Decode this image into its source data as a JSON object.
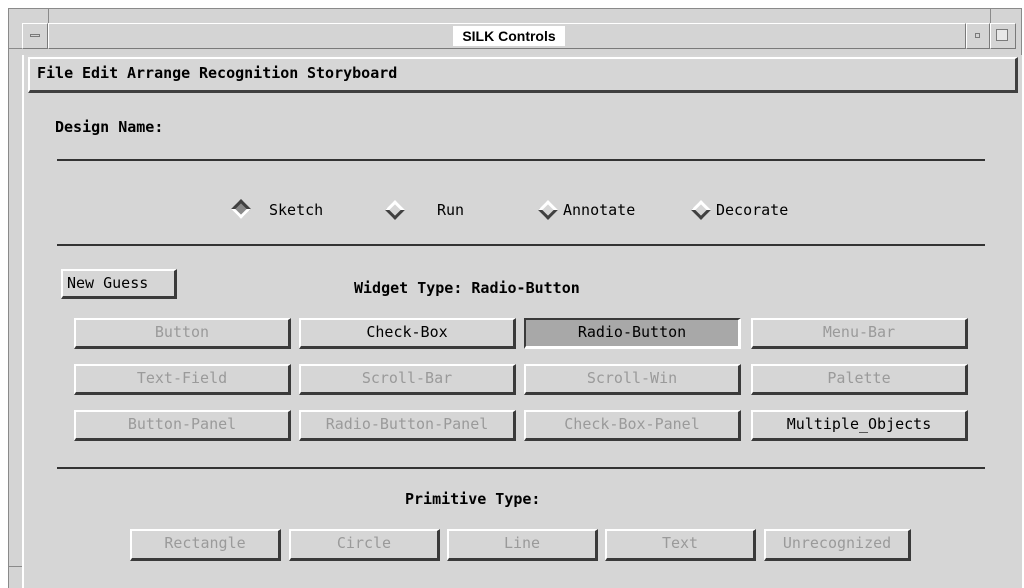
{
  "window": {
    "title": "SILK Controls"
  },
  "menubar": {
    "items": [
      "File",
      "Edit",
      "Arrange",
      "Recognition",
      "Storyboard"
    ]
  },
  "design_name": {
    "label": "Design Name:"
  },
  "modes": [
    {
      "label": "Sketch",
      "selected": true
    },
    {
      "label": "Run",
      "selected": false
    },
    {
      "label": "Annotate",
      "selected": false
    },
    {
      "label": "Decorate",
      "selected": false
    }
  ],
  "new_guess_label": "New Guess",
  "widget_type": {
    "label": "Widget Type: Radio-Button"
  },
  "widgets": [
    {
      "label": "Button",
      "state": "disabled"
    },
    {
      "label": "Check-Box",
      "state": "enabled"
    },
    {
      "label": "Radio-Button",
      "state": "selected"
    },
    {
      "label": "Menu-Bar",
      "state": "disabled"
    },
    {
      "label": "Text-Field",
      "state": "disabled"
    },
    {
      "label": "Scroll-Bar",
      "state": "disabled"
    },
    {
      "label": "Scroll-Win",
      "state": "disabled"
    },
    {
      "label": "Palette",
      "state": "disabled"
    },
    {
      "label": "Button-Panel",
      "state": "disabled"
    },
    {
      "label": "Radio-Button-Panel",
      "state": "disabled"
    },
    {
      "label": "Check-Box-Panel",
      "state": "disabled"
    },
    {
      "label": "Multiple_Objects",
      "state": "enabled"
    }
  ],
  "primitive_type": {
    "label": "Primitive Type:"
  },
  "primitives": [
    {
      "label": "Rectangle",
      "state": "disabled"
    },
    {
      "label": "Circle",
      "state": "disabled"
    },
    {
      "label": "Line",
      "state": "disabled"
    },
    {
      "label": "Text",
      "state": "disabled"
    },
    {
      "label": "Unrecognized",
      "state": "disabled"
    }
  ]
}
